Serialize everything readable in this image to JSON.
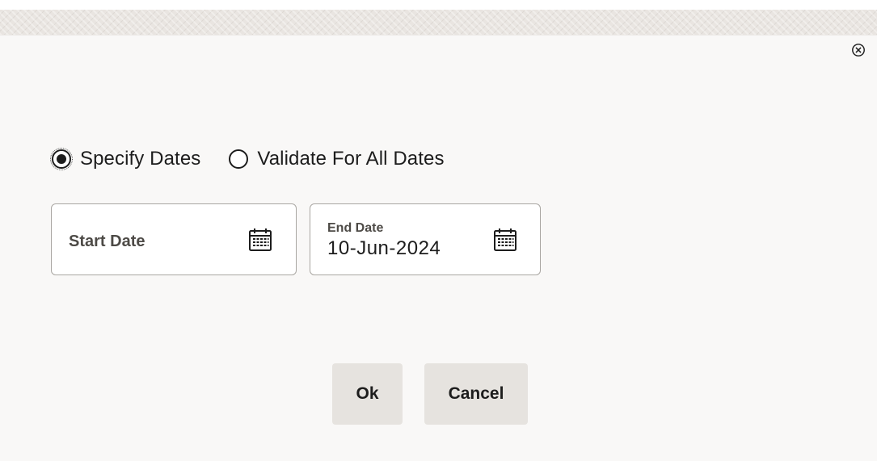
{
  "dialog": {
    "close_icon": "close-circle-icon"
  },
  "date_mode": {
    "options": [
      {
        "label": "Specify Dates",
        "selected": true
      },
      {
        "label": "Validate For All Dates",
        "selected": false
      }
    ]
  },
  "start_date": {
    "label": "Start Date",
    "value": "",
    "icon": "calendar-icon"
  },
  "end_date": {
    "label": "End Date",
    "value": "10-Jun-2024",
    "icon": "calendar-icon"
  },
  "actions": {
    "ok_label": "Ok",
    "cancel_label": "Cancel"
  },
  "colors": {
    "text": "#1d1d1d",
    "label": "#4d4a46",
    "button_bg": "#e6e3df",
    "field_border": "#a9a6a2"
  }
}
